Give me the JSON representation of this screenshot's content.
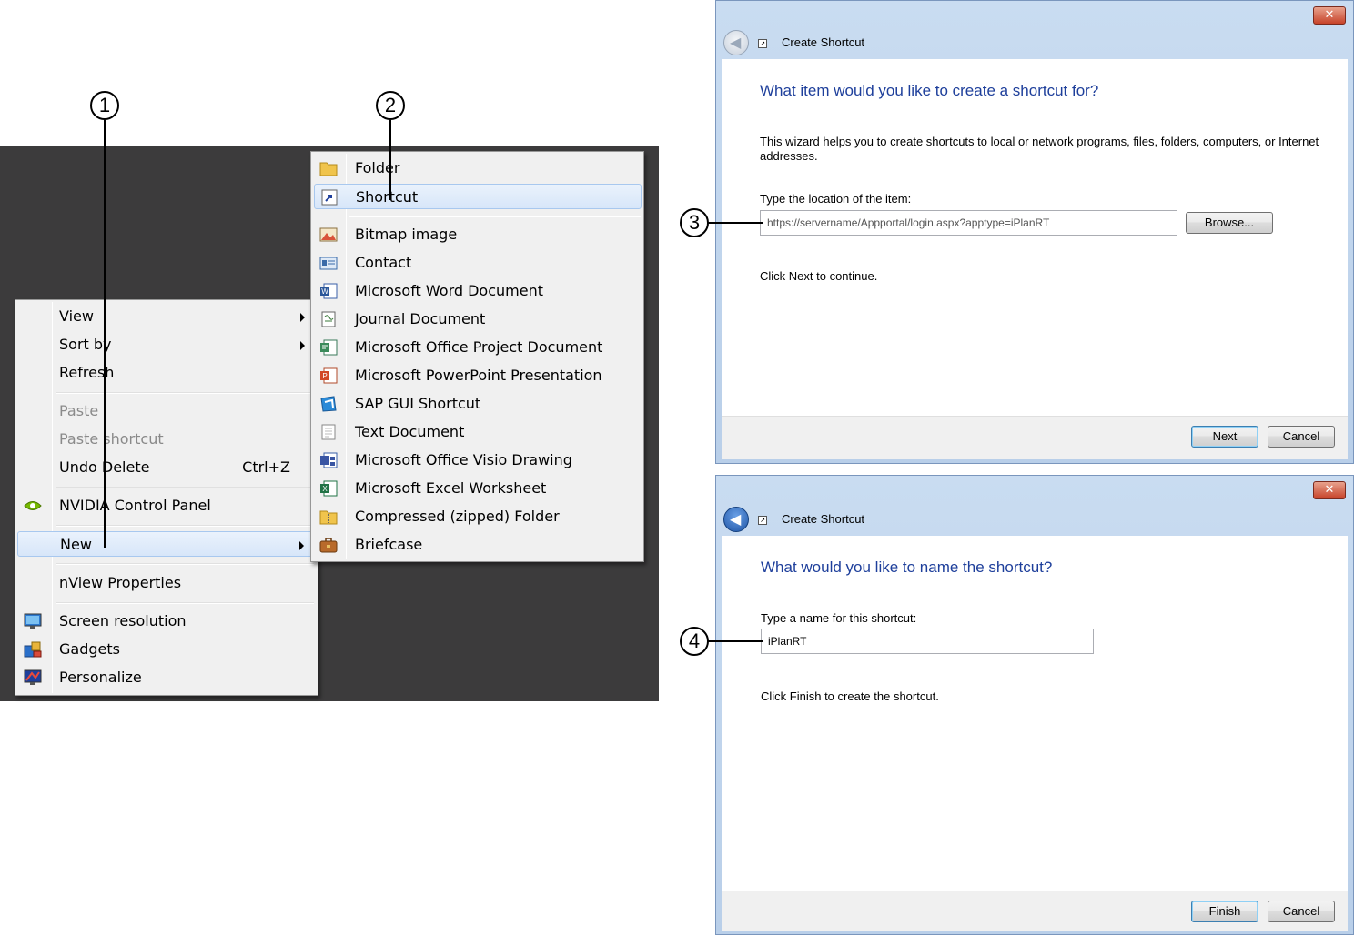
{
  "callouts": [
    "1",
    "2",
    "3",
    "4"
  ],
  "context_menu": {
    "items": [
      {
        "label": "View",
        "submenu": true
      },
      {
        "label": "Sort by",
        "submenu": true
      },
      {
        "label": "Refresh"
      },
      {
        "label": "Paste",
        "disabled": true
      },
      {
        "label": "Paste shortcut",
        "disabled": true
      },
      {
        "label": "Undo Delete",
        "accelerator": "Ctrl+Z"
      },
      {
        "label": "NVIDIA Control Panel",
        "icon": "nvidia-icon"
      },
      {
        "label": "New",
        "submenu": true,
        "highlighted": true
      },
      {
        "label": "nView Properties"
      },
      {
        "label": "Screen resolution",
        "icon": "monitor-icon"
      },
      {
        "label": "Gadgets",
        "icon": "gadgets-icon"
      },
      {
        "label": "Personalize",
        "icon": "personalize-icon"
      }
    ]
  },
  "new_submenu": {
    "items": [
      {
        "label": "Folder",
        "icon": "folder-icon"
      },
      {
        "label": "Shortcut",
        "icon": "shortcut-icon",
        "highlighted": true
      },
      {
        "label": "Bitmap image",
        "icon": "bitmap-icon"
      },
      {
        "label": "Contact",
        "icon": "contact-icon"
      },
      {
        "label": "Microsoft Word Document",
        "icon": "word-icon"
      },
      {
        "label": "Journal Document",
        "icon": "journal-icon"
      },
      {
        "label": "Microsoft Office Project Document",
        "icon": "project-icon"
      },
      {
        "label": "Microsoft PowerPoint Presentation",
        "icon": "powerpoint-icon"
      },
      {
        "label": "SAP GUI Shortcut",
        "icon": "sap-icon"
      },
      {
        "label": "Text Document",
        "icon": "text-document-icon"
      },
      {
        "label": "Microsoft Office Visio Drawing",
        "icon": "visio-icon"
      },
      {
        "label": "Microsoft Excel Worksheet",
        "icon": "excel-icon"
      },
      {
        "label": "Compressed (zipped) Folder",
        "icon": "zip-folder-icon"
      },
      {
        "label": "Briefcase",
        "icon": "briefcase-icon"
      }
    ]
  },
  "dialog1": {
    "title": "Create Shortcut",
    "close": "✕",
    "heading": "What item would you like to create a shortcut for?",
    "description": "This wizard helps you to create shortcuts to local or network programs, files, folders, computers, or Internet addresses.",
    "location_label": "Type the location of the item:",
    "location_value": "https://servername/Appportal/login.aspx?apptype=iPlanRT",
    "browse_label": "Browse...",
    "hint": "Click Next to continue.",
    "next_label": "Next",
    "cancel_label": "Cancel"
  },
  "dialog2": {
    "title": "Create Shortcut",
    "close": "✕",
    "heading": "What would you like to name the shortcut?",
    "name_label": "Type a name for this shortcut:",
    "name_value": "iPlanRT",
    "hint": "Click Finish to create the shortcut.",
    "finish_label": "Finish",
    "cancel_label": "Cancel"
  },
  "colors": {
    "desktop": "#3c3b3c",
    "heading_blue": "#1e3f9b",
    "highlight": "#d7e6f9"
  }
}
